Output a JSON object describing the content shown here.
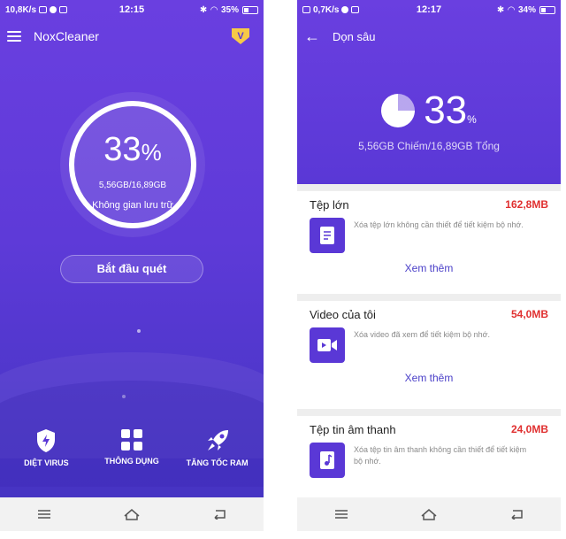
{
  "left_screen": {
    "status": {
      "speed": "10,8K/s",
      "time": "12:15",
      "battery": "35%"
    },
    "app_title": "NoxCleaner",
    "vip_badge": "V",
    "storage": {
      "percent": "33",
      "percent_unit": "%",
      "usage": "5,56GB/16,89GB",
      "label": "Không gian lưu trữ"
    },
    "scan_button": "Bắt đầu quét",
    "features": [
      {
        "label": "DIỆT VIRUS",
        "icon": "shield-icon"
      },
      {
        "label": "THÔNG DỤNG",
        "icon": "grid-icon"
      },
      {
        "label": "TĂNG TỐC RAM",
        "icon": "rocket-icon"
      }
    ]
  },
  "right_screen": {
    "status": {
      "speed": "0,7K/s",
      "time": "12:17",
      "battery": "34%"
    },
    "title": "Dọn sâu",
    "summary": {
      "percent": "33",
      "percent_unit": "%",
      "usage": "5,56GB Chiếm/16,89GB Tổng"
    },
    "categories": [
      {
        "title": "Tệp lớn",
        "size": "162,8MB",
        "description": "Xóa tệp lớn không cần thiết để tiết kiệm bộ nhớ.",
        "more": "Xem thêm",
        "icon": "document-icon"
      },
      {
        "title": "Video của tôi",
        "size": "54,0MB",
        "description": "Xóa video đã xem để tiết kiệm bộ nhớ.",
        "more": "Xem thêm",
        "icon": "video-icon"
      },
      {
        "title": "Tệp tin âm thanh",
        "size": "24,0MB",
        "description": "Xóa tệp tin âm thanh không cần thiết để tiết kiệm bộ nhớ.",
        "icon": "music-icon"
      }
    ]
  },
  "colors": {
    "primary_purple": "#5a38d6",
    "accent_red": "#e03030",
    "link_blue": "#4a3fc8"
  }
}
